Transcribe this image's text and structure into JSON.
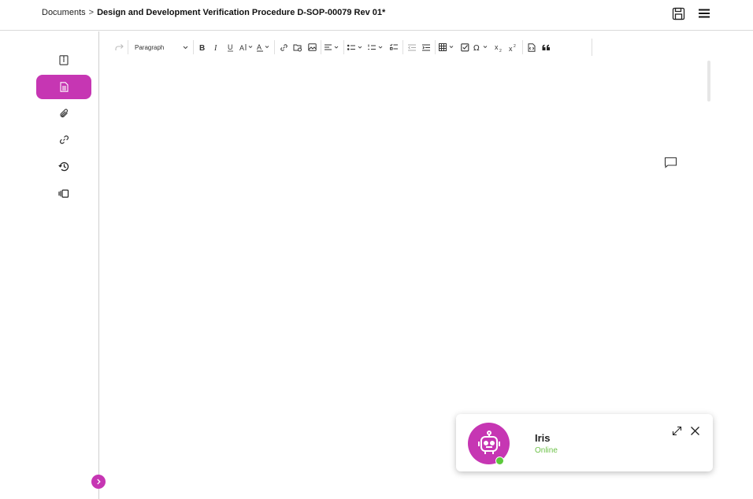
{
  "breadcrumb": {
    "root": "Documents",
    "separator": ">",
    "current": "Design and Development Verification Procedure D-SOP-00079 Rev 01*"
  },
  "header": {
    "icons": [
      "save-icon",
      "menu-icon"
    ]
  },
  "sidebar": {
    "items": [
      {
        "icon": "info-book-icon",
        "active": false
      },
      {
        "icon": "document-icon",
        "active": true
      },
      {
        "icon": "paperclip-icon",
        "active": false
      },
      {
        "icon": "link-icon",
        "active": false
      },
      {
        "icon": "history-icon",
        "active": false
      },
      {
        "icon": "versions-icon",
        "active": false
      }
    ],
    "collapse_icon": "chevron-right-icon"
  },
  "toolbar": {
    "paragraph_label": "Paragraph",
    "buttons": [
      "redo",
      "bold",
      "italic",
      "underline",
      "font-size",
      "font-color",
      "link",
      "insert-file",
      "insert-image",
      "align",
      "bulleted-list",
      "numbered-list",
      "todo-list",
      "outdent",
      "indent",
      "table",
      "checkbox",
      "special-characters",
      "subscript",
      "superscript",
      "source",
      "block-quote"
    ]
  },
  "editor": {
    "comment_icon": "comment-icon"
  },
  "chat": {
    "name": "Iris",
    "status": "Online",
    "icons": [
      "expand-icon",
      "close-icon"
    ]
  },
  "colors": {
    "accent": "#c636b3",
    "online": "#5cc93b",
    "status_text": "#6ec24a"
  }
}
